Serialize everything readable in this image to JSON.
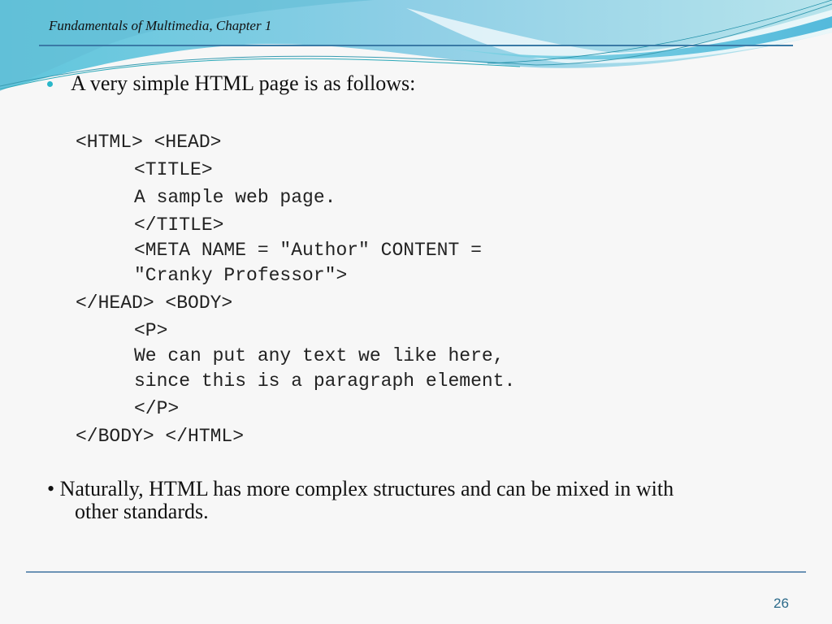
{
  "header": {
    "chapter_title": "Fundamentals of Multimedia, Chapter 1",
    "accent_color": "#5bc4dc"
  },
  "content": {
    "intro_bullet": "A very simple HTML page is as follows:",
    "code_lines": [
      "<HTML> <HEAD>",
      "<TITLE>",
      "A sample web page.",
      "</TITLE>",
      "<META NAME = \"Author\" CONTENT =",
      "\"Cranky Professor\">",
      "</HEAD> <BODY>",
      "<P>",
      "We can put any text we like here,",
      "since this is a paragraph element.",
      "</P>",
      "</BODY> </HTML>"
    ],
    "second_bullet_line1": "• Naturally, HTML has more complex structures and can be mixed in with",
    "second_bullet_line2": "other standards."
  },
  "footer": {
    "page_number": "26"
  }
}
